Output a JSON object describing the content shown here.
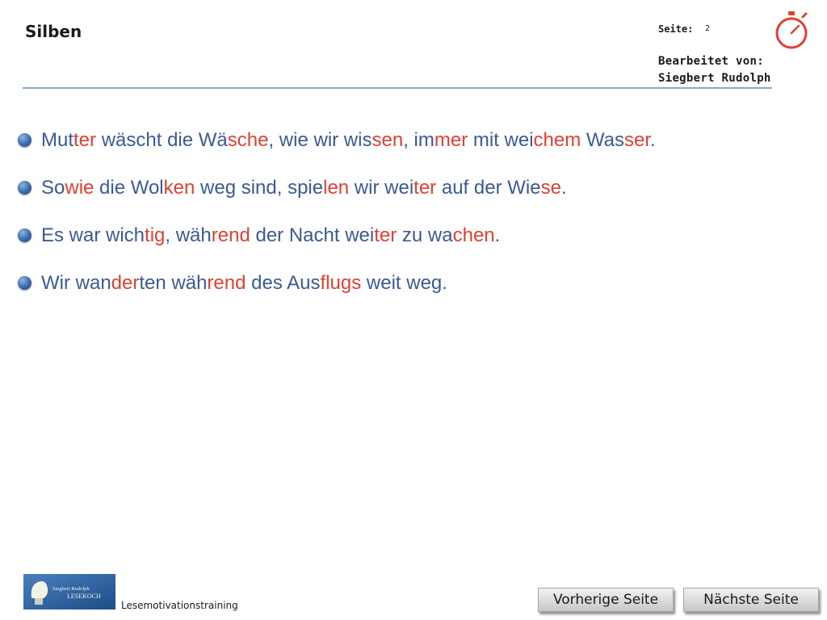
{
  "header": {
    "title": "Silben",
    "page_label": "Seite:",
    "page_number": "2",
    "edited_by_label": "Bearbeitet  von:",
    "edited_by_name": "Siegbert  Rudolph",
    "stopwatch_icon": "stopwatch-icon",
    "accent_color": "#e04030"
  },
  "sentences": [
    [
      [
        "Mut",
        false
      ],
      [
        "ter",
        true
      ],
      [
        " wäscht die Wä",
        false
      ],
      [
        "sche",
        true
      ],
      [
        ", wie wir wis",
        false
      ],
      [
        "sen",
        true
      ],
      [
        ", im",
        false
      ],
      [
        "mer",
        true
      ],
      [
        " mit wei",
        false
      ],
      [
        "chem",
        true
      ],
      [
        " Was",
        false
      ],
      [
        "ser",
        true
      ],
      [
        ".",
        false
      ]
    ],
    [
      [
        "So",
        false
      ],
      [
        "wie",
        true
      ],
      [
        " die Wol",
        false
      ],
      [
        "ken",
        true
      ],
      [
        " weg sind, spie",
        false
      ],
      [
        "len",
        true
      ],
      [
        " wir wei",
        false
      ],
      [
        "ter",
        true
      ],
      [
        " auf der Wie",
        false
      ],
      [
        "se",
        true
      ],
      [
        ".",
        false
      ]
    ],
    [
      [
        "Es war wich",
        false
      ],
      [
        "tig",
        true
      ],
      [
        ", wäh",
        false
      ],
      [
        "rend",
        true
      ],
      [
        " der Nacht wei",
        false
      ],
      [
        "ter",
        true
      ],
      [
        " zu wa",
        false
      ],
      [
        "chen",
        true
      ],
      [
        ".",
        false
      ]
    ],
    [
      [
        "Wir wan",
        false
      ],
      [
        "der",
        true
      ],
      [
        "ten wäh",
        false
      ],
      [
        "rend",
        true
      ],
      [
        " des Aus",
        false
      ],
      [
        "flugs",
        true
      ],
      [
        " weit weg.",
        false
      ]
    ]
  ],
  "footer": {
    "logo_line1": "Siegbert Rudolph",
    "logo_line2": "LESEKOCH",
    "label": "Lesemotivationstraining",
    "prev_label": "Vorherige Seite",
    "next_label": "Nächste Seite"
  }
}
